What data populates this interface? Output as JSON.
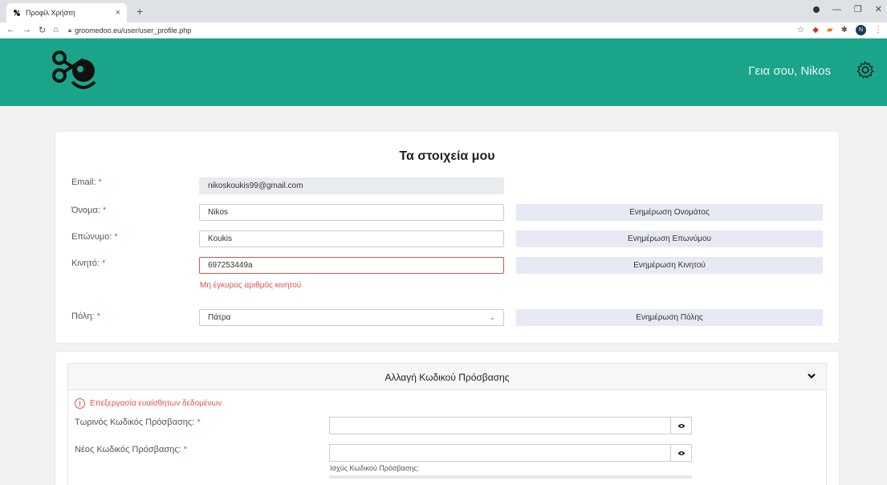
{
  "browser": {
    "tab_title": "Προφίλ Χρήστη",
    "tab_close": "×",
    "new_tab": "+",
    "url": "groomedoo.eu/user/user_profile.php",
    "profile_initial": "N"
  },
  "header": {
    "greeting": "Γεια σου, Nikos",
    "bg_color": "#1aa58a"
  },
  "profile_card": {
    "title": "Τα στοιχεία μου",
    "required_mark": "*",
    "email": {
      "label": "Email:",
      "value": "nikoskoukis99@gmail.com"
    },
    "name": {
      "label": "Όνομα:",
      "value": "Nikos",
      "button": "Ενημέρωση Ονομάτος"
    },
    "surname": {
      "label": "Επώνυμο:",
      "value": "Koukis",
      "button": "Ενημέρωση Επωνύμου"
    },
    "mobile": {
      "label": "Κινητό:",
      "value": "697253449a",
      "button": "Ενημέρωση Κινητού",
      "error": "Μη έγκυρος αριθμός κινητού"
    },
    "city": {
      "label": "Πόλη:",
      "value": "Πάτρα",
      "button": "Ενημέρωση Πόλης"
    }
  },
  "password_card": {
    "title": "Αλλαγή Κωδικού Πρόσβασης",
    "warning": "Επεξεργασία ευαίσθητων δεδομένων",
    "warning_icon": "!",
    "current": {
      "label": "Τωρινός Κωδικός Πρόσβασης:",
      "value": ""
    },
    "new": {
      "label": "Νέος Κωδικός Πρόσβασης:",
      "value": ""
    },
    "strength_label": "Ισχύς Κωδικού Πρόσβασης:"
  },
  "colors": {
    "accent": "#1aa58a",
    "error": "#d9534f",
    "button_bg": "#e7eaf4"
  }
}
